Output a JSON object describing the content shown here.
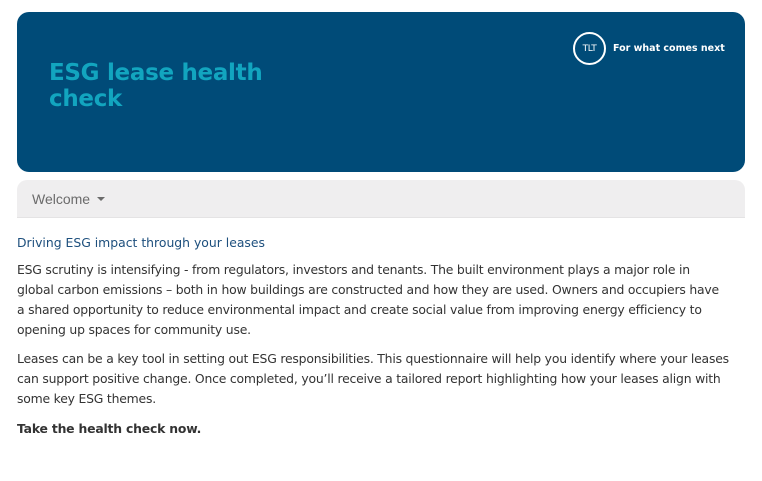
{
  "banner": {
    "title": "ESG lease health check",
    "logo_text": "TLT",
    "tagline": "For what comes next",
    "background_color": "#004b78",
    "title_color": "#12a5bf"
  },
  "nav": {
    "dropdown_label": "Welcome"
  },
  "content": {
    "heading": "Driving ESG impact through your leases",
    "paragraph_1": "ESG scrutiny is intensifying - from regulators, investors and tenants. The built environment plays a major role in global carbon emissions – both in how buildings are constructed and how they are used. Owners and occupiers have a shared opportunity to reduce environmental impact and create social value from improving energy efficiency to opening up spaces for community use.",
    "paragraph_2": "Leases can be a key tool in setting out ESG responsibilities. This questionnaire will help you identify where your leases can support positive change. Once completed, you’ll receive a tailored report highlighting how your leases align with some key ESG themes.",
    "call_to_action": "Take the health check now."
  }
}
